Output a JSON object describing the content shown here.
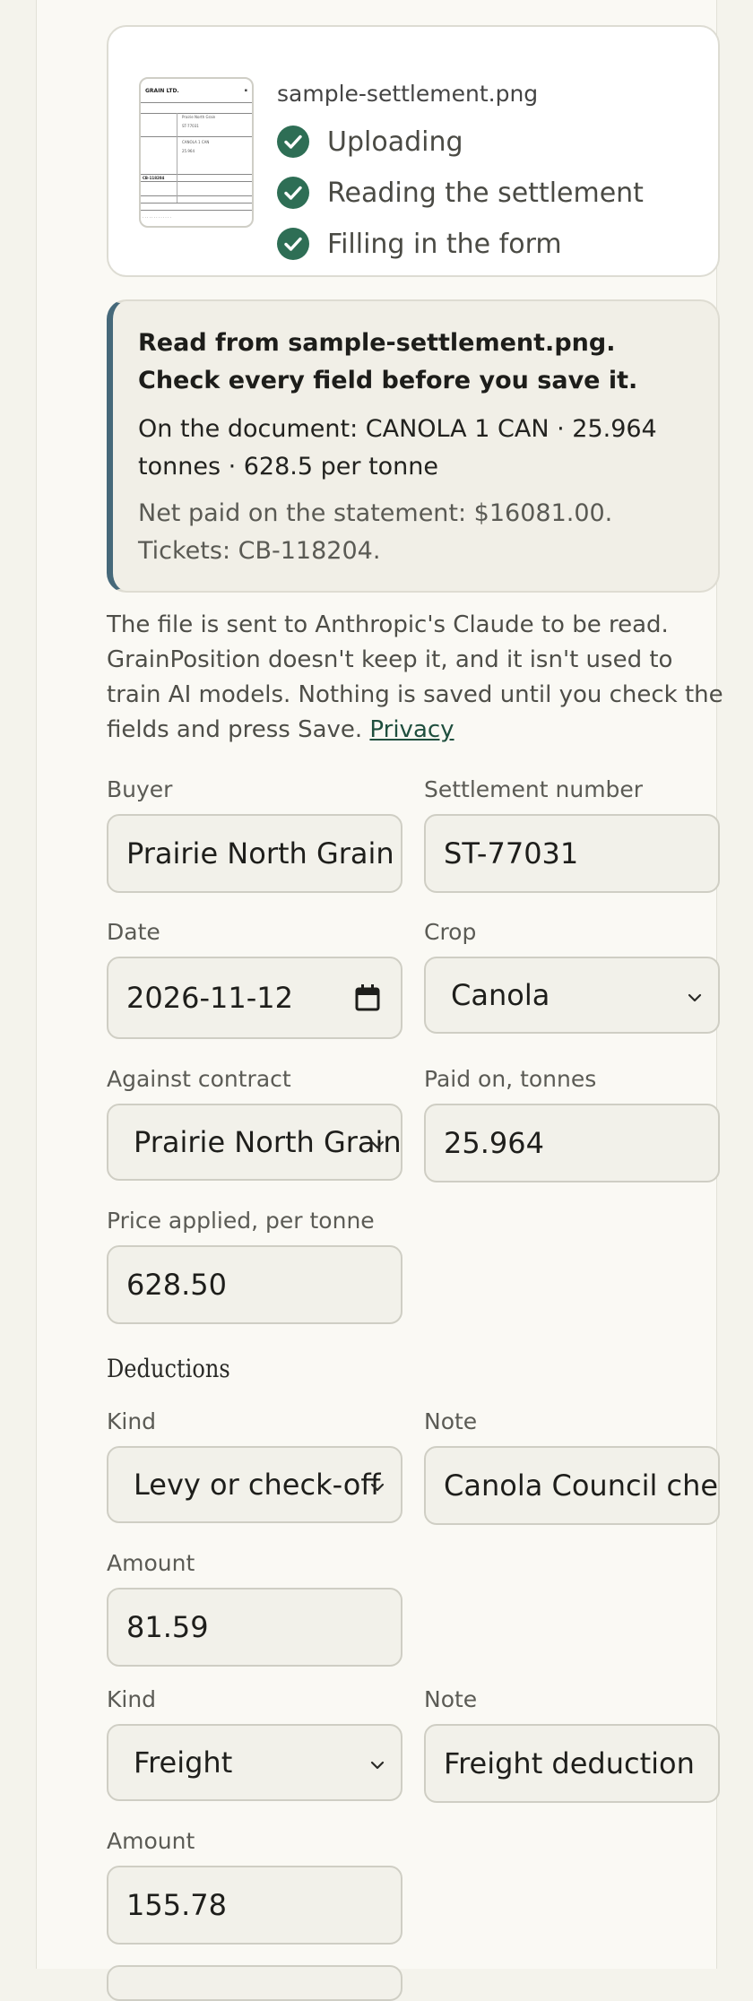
{
  "upload": {
    "filename": "sample-settlement.png",
    "steps": [
      {
        "label": "Uploading",
        "status": "done"
      },
      {
        "label": "Reading the settlement",
        "status": "done"
      },
      {
        "label": "Filling in the form",
        "status": "done"
      }
    ],
    "thumbnail": {
      "header": "GRAIN LTD.",
      "lines": [
        "Prairie North Grain",
        "ST-77031",
        "CANOLA 1 CAN",
        "CB-118204"
      ]
    }
  },
  "notice": {
    "title": "Read from sample-settlement.png. Check every field before you save it.",
    "document_line": "On the document: CANOLA 1 CAN · 25.964 tonnes · 628.5 per tonne",
    "net_line": "Net paid on the statement: $16081.00. Tickets: CB-118204."
  },
  "privacy": {
    "text": "The file is sent to Anthropic's Claude to be read. GrainPosition doesn't keep it, and it isn't used to train AI models. Nothing is saved until you check the fields and press Save.",
    "link": "Privacy"
  },
  "form": {
    "buyer": {
      "label": "Buyer",
      "value": "Prairie North Grain Ltd."
    },
    "settlement_number": {
      "label": "Settlement number",
      "value": "ST-77031"
    },
    "date": {
      "label": "Date",
      "value": "2026-11-12"
    },
    "crop": {
      "label": "Crop",
      "value": "Canola"
    },
    "contract": {
      "label": "Against contract",
      "value": "Prairie North Grain"
    },
    "tonnes": {
      "label": "Paid on, tonnes",
      "value": "25.964"
    },
    "price": {
      "label": "Price applied, per tonne",
      "value": "628.50"
    }
  },
  "deductions": {
    "heading": "Deductions",
    "items": [
      {
        "kind_label": "Kind",
        "kind": "Levy or check-off",
        "note_label": "Note",
        "note": "Canola Council check-off",
        "amount_label": "Amount",
        "amount": "81.59"
      },
      {
        "kind_label": "Kind",
        "kind": "Freight",
        "note_label": "Note",
        "note": "Freight deduction",
        "amount_label": "Amount",
        "amount": "155.78"
      }
    ]
  },
  "colors": {
    "accent_green": "#2e6e55",
    "notice_bar": "#46697a",
    "background": "#f4f3ec"
  }
}
